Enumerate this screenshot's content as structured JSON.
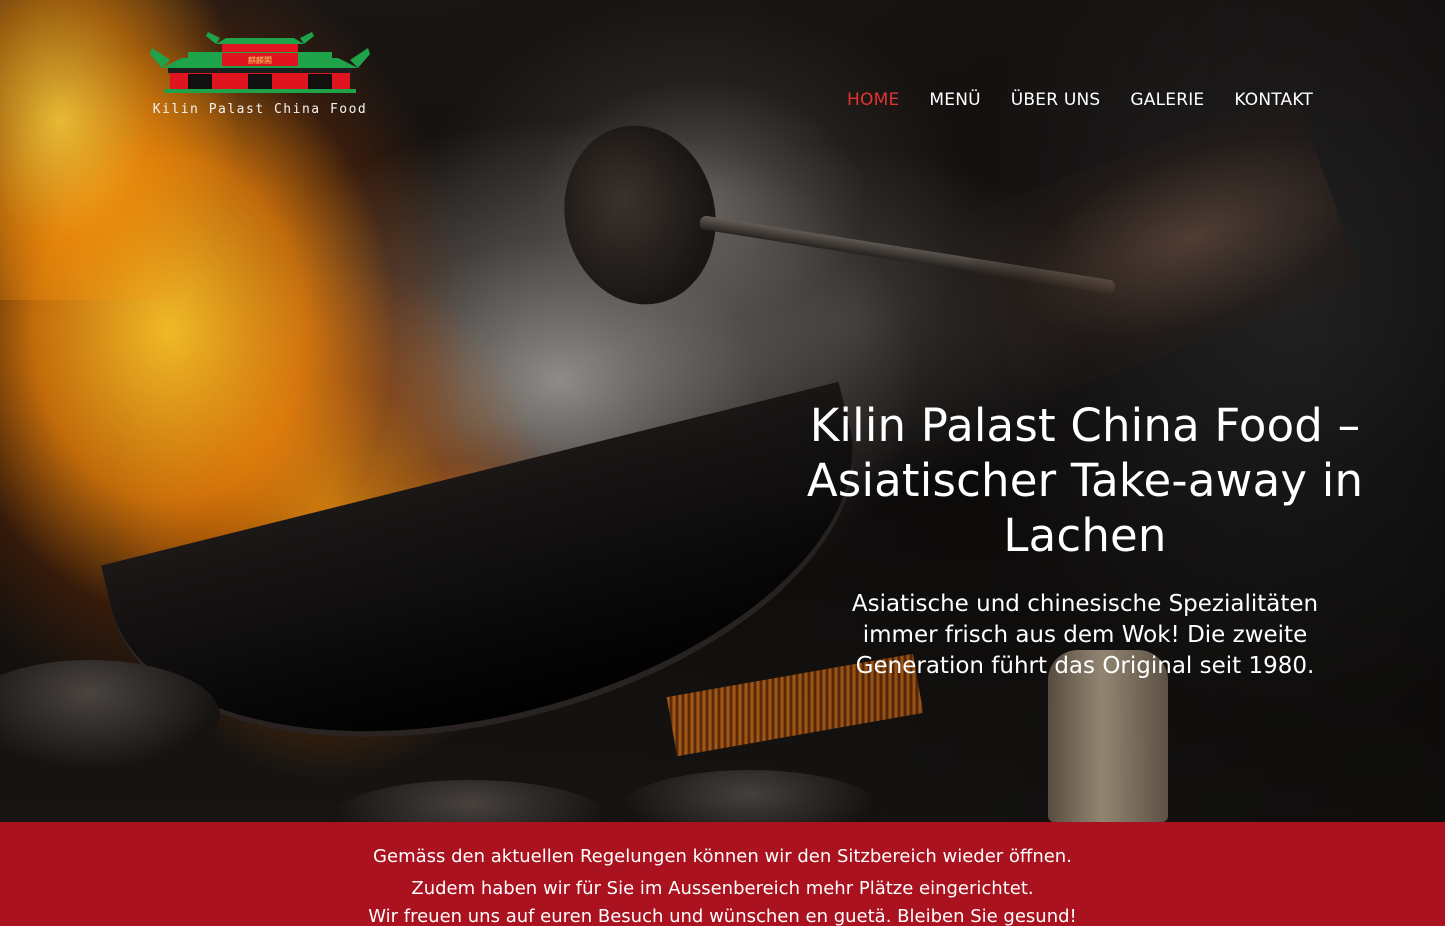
{
  "brand": {
    "logo_text": "Kilin Palast China Food",
    "logo_sign": "麒麟閣",
    "colors": {
      "roof_green": "#1fa34a",
      "palace_red": "#e0141e"
    }
  },
  "nav": {
    "items": [
      {
        "label": "HOME",
        "active": true
      },
      {
        "label": "MENÜ",
        "active": false
      },
      {
        "label": "ÜBER UNS",
        "active": false
      },
      {
        "label": "GALERIE",
        "active": false
      },
      {
        "label": "KONTAKT",
        "active": false
      }
    ],
    "active_color": "#e3342f"
  },
  "hero": {
    "title": "Kilin Palast China Food – Asiatischer Take-away in Lachen",
    "subtitle": "Asiatische und chinesische Spezialitäten immer frisch aus dem Wok! Die zweite Generation führt das Original seit 1980."
  },
  "notice": {
    "background": "#a9121e",
    "lines": [
      "Gemäss den aktuellen Regelungen können wir den Sitzbereich wieder öffnen.",
      "Zudem haben wir für Sie im Aussenbereich mehr Plätze eingerichtet.",
      "Wir freuen uns auf euren Besuch und wünschen en guetä. Bleiben Sie gesund!"
    ]
  }
}
